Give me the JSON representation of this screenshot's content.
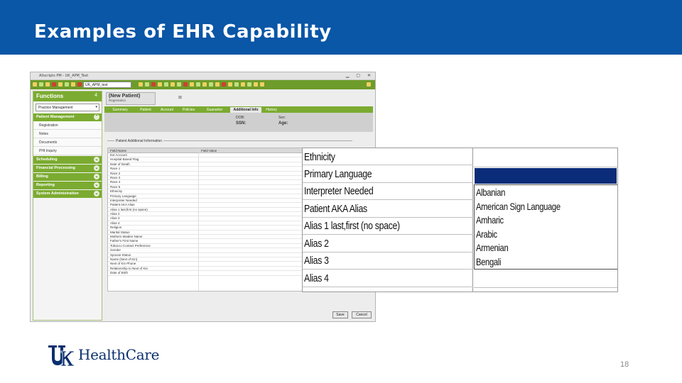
{
  "slide": {
    "title": "Examples of EHR Capability",
    "page_number": "18",
    "logo_text": "HealthCare",
    "logo_mark": "UK"
  },
  "colors": {
    "header_blue": "#0a56a7",
    "ehr_green": "#7bab30",
    "highlight_navy": "#0b2c78",
    "logo_navy": "#0a2f6e"
  },
  "ehr": {
    "window_title": "Allscripts PM - UK_APM_Test",
    "toolbar_select": "UK_APM_test",
    "functions": {
      "heading": "Functions",
      "count": "4",
      "dropdown_value": "Practice Management",
      "modules": [
        {
          "label": "Patient Management",
          "expanded": true,
          "items": [
            "Registration",
            "Notes",
            "Documents",
            "PHI Inquiry"
          ]
        },
        {
          "label": "Scheduling",
          "expanded": false,
          "items": []
        },
        {
          "label": "Financial Processing",
          "expanded": false,
          "items": []
        },
        {
          "label": "Billing",
          "expanded": false,
          "items": []
        },
        {
          "label": "Reporting",
          "expanded": false,
          "items": []
        },
        {
          "label": "System Administration",
          "expanded": false,
          "items": []
        }
      ]
    },
    "record_tab": {
      "title": "(New Patient)",
      "subtitle": "Registration"
    },
    "form_tabs": [
      "Summary",
      "Patient",
      "Account",
      "Policies",
      "Guarantor",
      "Additional Info",
      "History"
    ],
    "active_tab_index": 5,
    "patient_info": [
      {
        "label": "DOB:",
        "value": "SSN:"
      },
      {
        "label": "Sex:",
        "value": "Age:"
      }
    ],
    "group_label": "Patient Additional Information",
    "grid_columns": [
      "Field Name",
      "Field Value"
    ],
    "grid_rows": [
      "Ext Account",
      "Hospital Based Flag",
      "Date of Death",
      "Race 1",
      "Race 2",
      "Race 3",
      "Race 4",
      "Race 5",
      "Ethnicity",
      "Primary Language",
      "Interpreter Needed",
      "Patient AKA Alias",
      "Alias 1 last,first (no space)",
      "Alias 2",
      "Alias 3",
      "Alias 4",
      "Religion",
      "Marital Status",
      "Mothers Maiden Name",
      "Father's First Name",
      "Tobacco Contact Preference",
      "Gender",
      "Spouse Status",
      "Name (Next of Kin)",
      "Next of Kin Phone",
      "Relationship to Next of Kin",
      "Date of Birth"
    ],
    "buttons": {
      "save": "Save",
      "cancel": "Cancel"
    }
  },
  "zoom_callout": {
    "field_labels": [
      "Ethnicity",
      "Primary Language",
      "Interpreter Needed",
      "Patient AKA Alias",
      "Alias 1 last,first (no space)",
      "Alias 2",
      "Alias 3",
      "Alias 4"
    ],
    "dropdown_options": [
      "Albanian",
      "American Sign Language",
      "Amharic",
      "Arabic",
      "Armenian",
      "Bengali"
    ]
  }
}
